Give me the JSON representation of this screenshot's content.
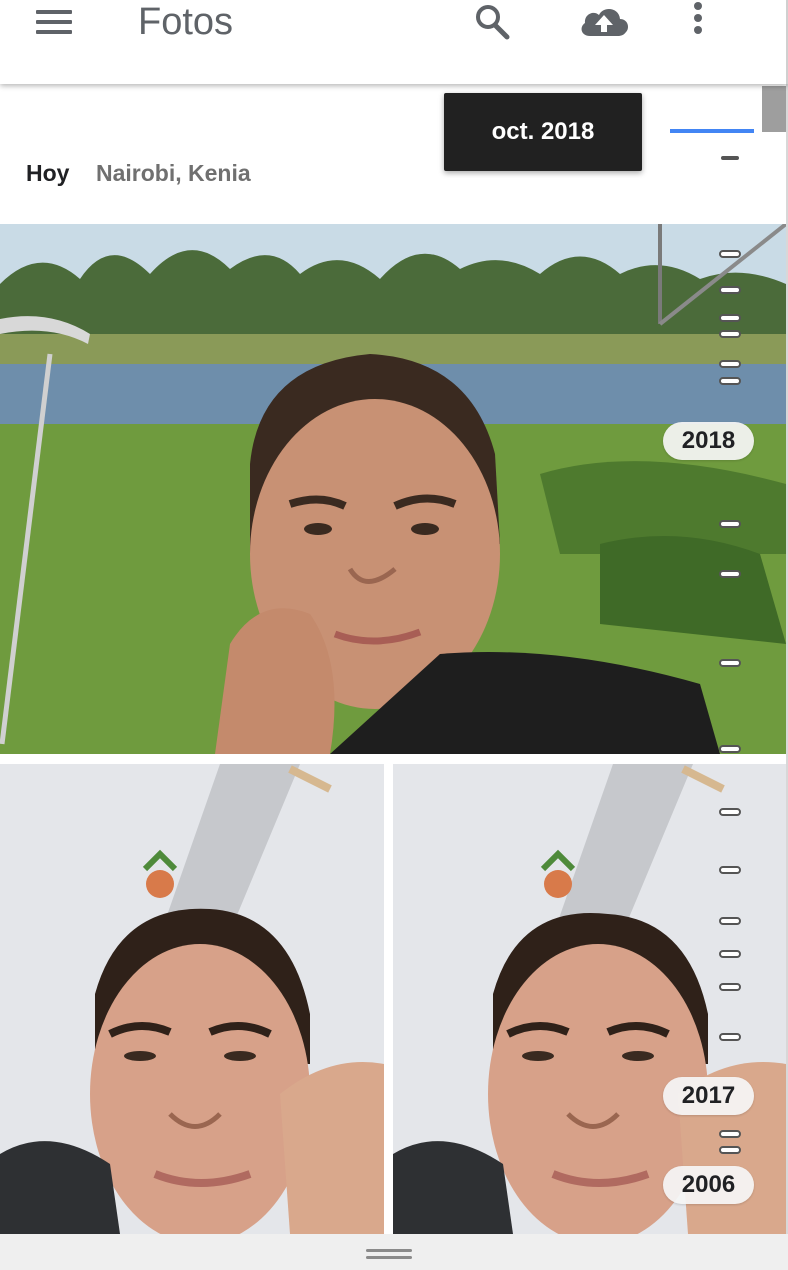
{
  "appbar": {
    "title": "Fotos",
    "icons": [
      "menu-icon",
      "search-icon",
      "cloud-upload-icon",
      "more-vert-icon"
    ]
  },
  "section": {
    "date": "Hoy",
    "place": "Nairobi, Kenia"
  },
  "scrubber": {
    "tooltip": "oct. 2018",
    "year_labels": [
      "2018",
      "2017",
      "2006"
    ]
  },
  "photos": [
    {
      "name": "lake-selfie"
    },
    {
      "name": "indoor-selfie-1"
    },
    {
      "name": "indoor-selfie-2"
    }
  ],
  "colors": {
    "tooltip_bg": "#212121",
    "accent": "#4285f4",
    "title": "#5f6368"
  }
}
